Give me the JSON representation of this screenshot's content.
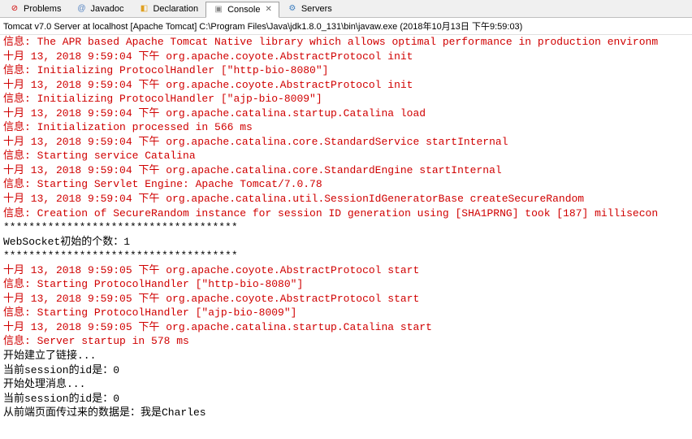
{
  "tabs": {
    "problems": {
      "label": "Problems",
      "icon": "⊘"
    },
    "javadoc": {
      "label": "Javadoc",
      "icon": "@"
    },
    "declaration": {
      "label": "Declaration",
      "icon": "◧"
    },
    "console": {
      "label": "Console",
      "icon": "▣",
      "close": "✕"
    },
    "servers": {
      "label": "Servers",
      "icon": "⚙"
    }
  },
  "launch": "Tomcat v7.0 Server at localhost [Apache Tomcat] C:\\Program Files\\Java\\jdk1.8.0_131\\bin\\javaw.exe (2018年10月13日 下午9:59:03)",
  "lines": [
    {
      "text": "信息: The APR based Apache Tomcat Native library which allows optimal performance in production environm",
      "color": "red"
    },
    {
      "text": "十月 13, 2018 9:59:04 下午 org.apache.coyote.AbstractProtocol init",
      "color": "red"
    },
    {
      "text": "信息: Initializing ProtocolHandler [\"http-bio-8080\"]",
      "color": "red"
    },
    {
      "text": "十月 13, 2018 9:59:04 下午 org.apache.coyote.AbstractProtocol init",
      "color": "red"
    },
    {
      "text": "信息: Initializing ProtocolHandler [\"ajp-bio-8009\"]",
      "color": "red"
    },
    {
      "text": "十月 13, 2018 9:59:04 下午 org.apache.catalina.startup.Catalina load",
      "color": "red"
    },
    {
      "text": "信息: Initialization processed in 566 ms",
      "color": "red"
    },
    {
      "text": "十月 13, 2018 9:59:04 下午 org.apache.catalina.core.StandardService startInternal",
      "color": "red"
    },
    {
      "text": "信息: Starting service Catalina",
      "color": "red"
    },
    {
      "text": "十月 13, 2018 9:59:04 下午 org.apache.catalina.core.StandardEngine startInternal",
      "color": "red"
    },
    {
      "text": "信息: Starting Servlet Engine: Apache Tomcat/7.0.78",
      "color": "red"
    },
    {
      "text": "十月 13, 2018 9:59:04 下午 org.apache.catalina.util.SessionIdGeneratorBase createSecureRandom",
      "color": "red"
    },
    {
      "text": "信息: Creation of SecureRandom instance for session ID generation using [SHA1PRNG] took [187] millisecon",
      "color": "red"
    },
    {
      "text": "*************************************",
      "color": "black"
    },
    {
      "text": "WebSocket初始的个数：1",
      "color": "black"
    },
    {
      "text": "*************************************",
      "color": "black"
    },
    {
      "text": "十月 13, 2018 9:59:05 下午 org.apache.coyote.AbstractProtocol start",
      "color": "red"
    },
    {
      "text": "信息: Starting ProtocolHandler [\"http-bio-8080\"]",
      "color": "red"
    },
    {
      "text": "十月 13, 2018 9:59:05 下午 org.apache.coyote.AbstractProtocol start",
      "color": "red"
    },
    {
      "text": "信息: Starting ProtocolHandler [\"ajp-bio-8009\"]",
      "color": "red"
    },
    {
      "text": "十月 13, 2018 9:59:05 下午 org.apache.catalina.startup.Catalina start",
      "color": "red"
    },
    {
      "text": "信息: Server startup in 578 ms",
      "color": "red"
    },
    {
      "text": "开始建立了链接...",
      "color": "black"
    },
    {
      "text": "当前session的id是：0",
      "color": "black"
    },
    {
      "text": "开始处理消息...",
      "color": "black"
    },
    {
      "text": "当前session的id是：0",
      "color": "black"
    },
    {
      "text": "从前端页面传过来的数据是：我是Charles",
      "color": "black"
    }
  ]
}
